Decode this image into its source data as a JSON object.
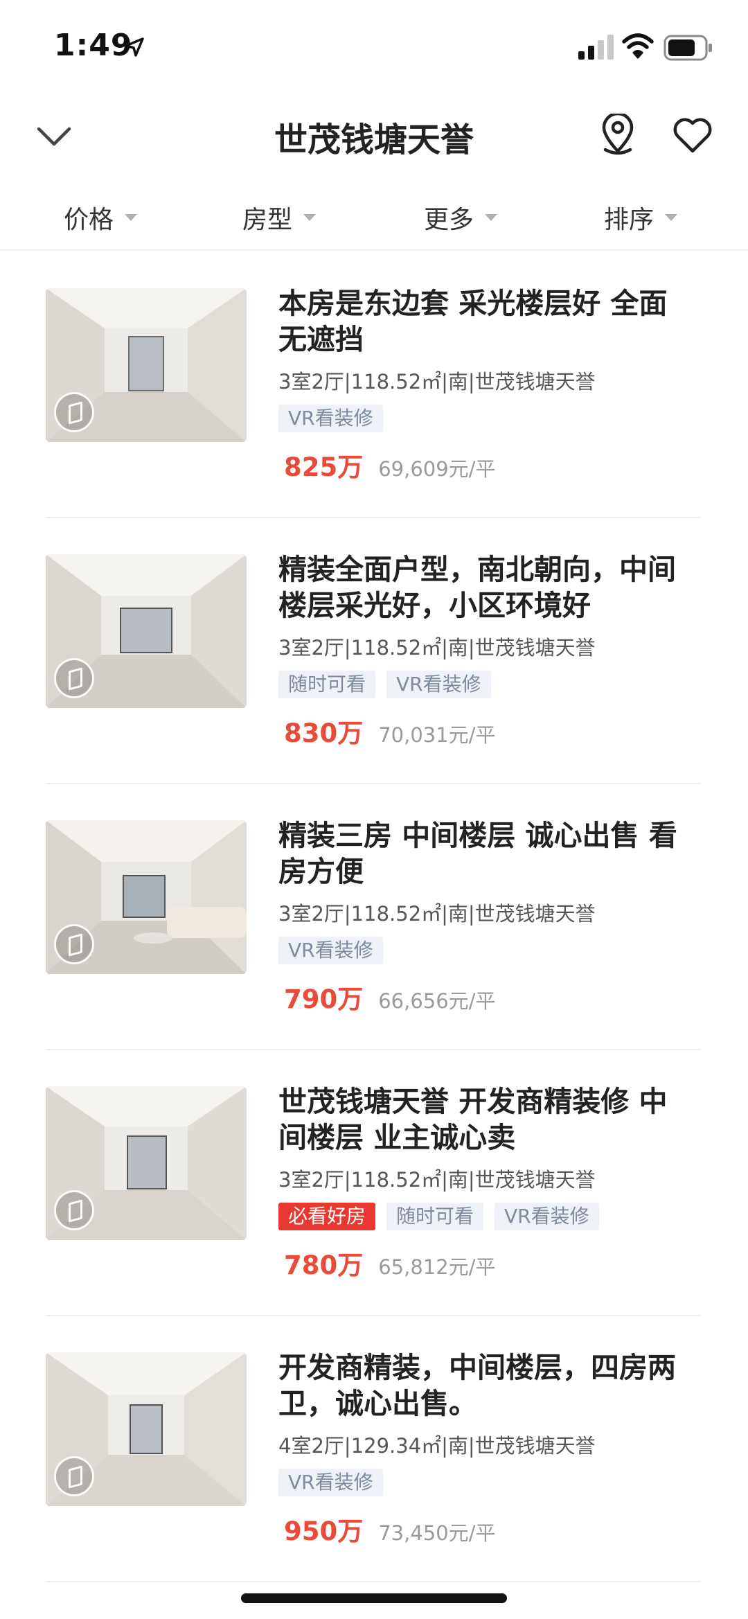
{
  "status_bar": {
    "time": "1:49"
  },
  "nav": {
    "title": "世茂钱塘天誉",
    "icons": [
      "chevron-down-icon",
      "map-pin-icon",
      "heart-icon"
    ]
  },
  "filters": [
    {
      "label": "价格"
    },
    {
      "label": "房型"
    },
    {
      "label": "更多"
    },
    {
      "label": "排序"
    }
  ],
  "listings": [
    {
      "title": "本房是东边套 采光楼层好  全面无遮挡",
      "meta": "3室2厅|118.52㎡|南|世茂钱塘天誉",
      "tags": [
        {
          "text": "VR看装修",
          "style": "normal"
        }
      ],
      "price": "825万",
      "unit_price": "69,609元/平"
    },
    {
      "title": "精装全面户型，南北朝向，中间楼层采光好，小区环境好",
      "meta": "3室2厅|118.52㎡|南|世茂钱塘天誉",
      "tags": [
        {
          "text": "随时可看",
          "style": "normal"
        },
        {
          "text": "VR看装修",
          "style": "normal"
        }
      ],
      "price": "830万",
      "unit_price": "70,031元/平"
    },
    {
      "title": "精装三房 中间楼层 诚心出售 看房方便",
      "meta": "3室2厅|118.52㎡|南|世茂钱塘天誉",
      "tags": [
        {
          "text": "VR看装修",
          "style": "normal"
        }
      ],
      "price": "790万",
      "unit_price": "66,656元/平"
    },
    {
      "title": "世茂钱塘天誉   开发商精装修 中间楼层  业主诚心卖",
      "meta": "3室2厅|118.52㎡|南|世茂钱塘天誉",
      "tags": [
        {
          "text": "必看好房",
          "style": "hot"
        },
        {
          "text": "随时可看",
          "style": "normal"
        },
        {
          "text": "VR看装修",
          "style": "normal"
        }
      ],
      "price": "780万",
      "unit_price": "65,812元/平"
    },
    {
      "title": "开发商精装，中间楼层，四房两卫，诚心出售。",
      "meta": "4室2厅|129.34㎡|南|世茂钱塘天誉",
      "tags": [
        {
          "text": "VR看装修",
          "style": "normal"
        }
      ],
      "price": "950万",
      "unit_price": "73,450元/平"
    }
  ],
  "colors": {
    "price": "#ec4a38",
    "hot_tag": "#e8382f",
    "tag_bg": "#eef2f7",
    "tag_text": "#7d8a9a"
  }
}
